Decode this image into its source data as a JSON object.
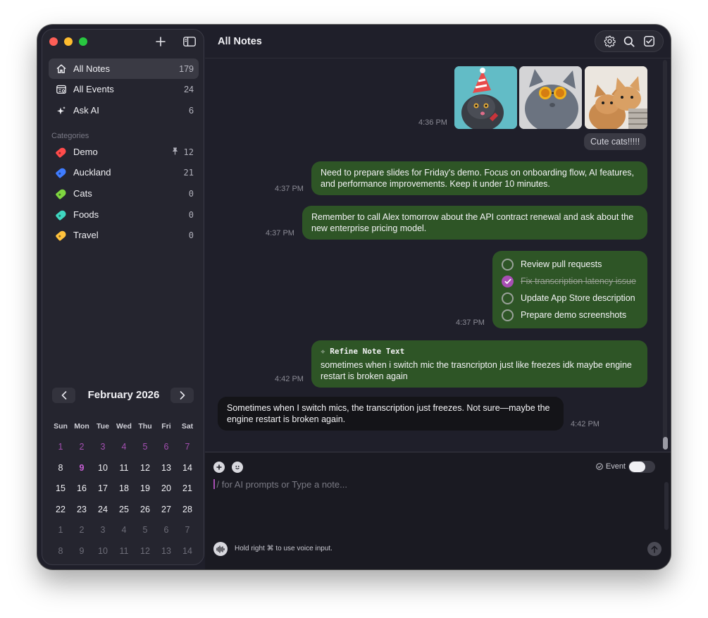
{
  "header": {
    "title": "All Notes"
  },
  "sidebar": {
    "nav": [
      {
        "label": "All Notes",
        "count": "179",
        "icon": "house-icon"
      },
      {
        "label": "All Events",
        "count": "24",
        "icon": "calendar-list-icon"
      },
      {
        "label": "Ask AI",
        "count": "6",
        "icon": "sparkles-icon"
      }
    ],
    "categories_header": "Categories",
    "categories": [
      {
        "label": "Demo",
        "count": "12",
        "color": "#ff4b4b",
        "pinned": true
      },
      {
        "label": "Auckland",
        "count": "21",
        "color": "#3f7cff"
      },
      {
        "label": "Cats",
        "count": "0",
        "color": "#7fd640"
      },
      {
        "label": "Foods",
        "count": "0",
        "color": "#3fd6c0"
      },
      {
        "label": "Travel",
        "count": "0",
        "color": "#ffc23d"
      }
    ],
    "pin_glyph": "📌"
  },
  "calendar": {
    "title": "February 2026",
    "prev_glyph": "‹",
    "next_glyph": "›",
    "weekdays": [
      "Sun",
      "Mon",
      "Tue",
      "Wed",
      "Thu",
      "Fri",
      "Sat"
    ],
    "weeks": [
      [
        "1",
        "2",
        "3",
        "4",
        "5",
        "6",
        "7"
      ],
      [
        "8",
        "9",
        "10",
        "11",
        "12",
        "13",
        "14"
      ],
      [
        "15",
        "16",
        "17",
        "18",
        "19",
        "20",
        "21"
      ],
      [
        "22",
        "23",
        "24",
        "25",
        "26",
        "27",
        "28"
      ],
      [
        "1",
        "2",
        "3",
        "4",
        "5",
        "6",
        "7"
      ],
      [
        "8",
        "9",
        "10",
        "11",
        "12",
        "13",
        "14"
      ]
    ],
    "today": "9"
  },
  "messages": {
    "m1_time": "4:36 PM",
    "m1_caption": "Cute cats!!!!!",
    "m2_time": "4:37 PM",
    "m2_text": "Need to prepare slides for Friday's demo. Focus on onboarding flow, AI features, and performance improvements. Keep it under 10 minutes.",
    "m3_time": "4:37 PM",
    "m3_text": "Remember to call Alex tomorrow about the API contract renewal and ask about the new enterprise pricing model.",
    "m4_time": "4:37 PM",
    "todos": [
      {
        "text": "Review pull requests",
        "done": false
      },
      {
        "text": "Fix transcription latency issue",
        "done": true
      },
      {
        "text": "Update App Store description",
        "done": false
      },
      {
        "text": "Prepare demo screenshots",
        "done": false
      }
    ],
    "m5_time": "4:42 PM",
    "m5_label": "Refine Note Text",
    "m5_text": "sometimes when i switch mic the trasncripton just like freezes idk maybe engine restart is broken again",
    "m6_time": "4:42 PM",
    "m6_text": "Sometimes when I switch mics, the transcription just freezes. Not sure—maybe the engine restart is broken again."
  },
  "composer": {
    "placeholder": "/ for AI prompts or Type a note...",
    "event_label": "Event",
    "voice_hint": "Hold right ⌘ to use voice input."
  }
}
